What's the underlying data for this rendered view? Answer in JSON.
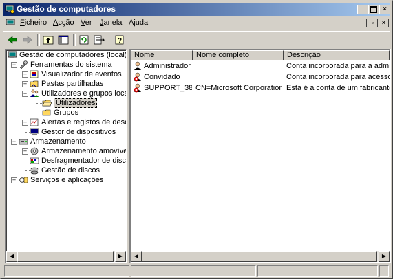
{
  "window": {
    "title": "Gestão de computadores"
  },
  "menu": {
    "items": [
      {
        "label": "Ficheiro",
        "u": "F",
        "rest": "icheiro"
      },
      {
        "label": "Acção",
        "u": "A",
        "rest": "cção"
      },
      {
        "label": "Ver",
        "u": "V",
        "rest": "er"
      },
      {
        "label": "Janela",
        "u": "J",
        "rest": "anela"
      },
      {
        "label": "Ajuda",
        "u": "j",
        "pre": "A",
        "rest": "uda"
      }
    ]
  },
  "tree": {
    "root": "Gestão de computadores (local)",
    "system_tools": "Ferramentas do sistema",
    "event_viewer": "Visualizador de eventos",
    "shared_folders": "Pastas partilhadas",
    "users_groups": "Utilizadores e grupos locais",
    "users": "Utilizadores",
    "groups": "Grupos",
    "alerts": "Alertas e registos de desempenho",
    "device_manager": "Gestor de dispositivos",
    "storage": "Armazenamento",
    "removable": "Armazenamento amovível",
    "defrag": "Desfragmentador de disco",
    "disk_mgmt": "Gestão de discos",
    "services": "Serviços e aplicações"
  },
  "list": {
    "columns": [
      "Nome",
      "Nome completo",
      "Descrição"
    ],
    "rows": [
      {
        "name": "Administrador",
        "full_name": "",
        "description": "Conta incorporada para a administração do computador/domínio",
        "disabled": false
      },
      {
        "name": "Convidado",
        "full_name": "",
        "description": "Conta incorporada para acesso convidado ao computador/domínio",
        "disabled": true
      },
      {
        "name": "SUPPORT_38...",
        "full_name": "CN=Microsoft Corporation...",
        "description": "Esta é a conta de um fabricante para o serviço de Ajuda e suporte",
        "disabled": true
      }
    ]
  },
  "colors": {
    "titlebar_start": "#0a246a",
    "titlebar_end": "#a6caf0",
    "face": "#d4d0c8"
  }
}
